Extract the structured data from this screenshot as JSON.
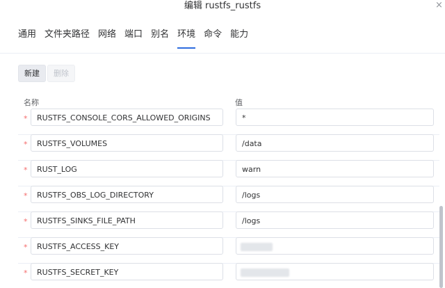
{
  "dialog": {
    "title": "编辑 rustfs_rustfs",
    "close_label": "×"
  },
  "tabs": [
    {
      "label": "通用",
      "active": false
    },
    {
      "label": "文件夹路径",
      "active": false
    },
    {
      "label": "网络",
      "active": false
    },
    {
      "label": "端口",
      "active": false
    },
    {
      "label": "别名",
      "active": false
    },
    {
      "label": "环境",
      "active": true
    },
    {
      "label": "命令",
      "active": false
    },
    {
      "label": "能力",
      "active": false
    }
  ],
  "toolbar": {
    "new_label": "新建",
    "delete_label": "删除"
  },
  "columns": {
    "name": "名称",
    "value": "值"
  },
  "required_marker": "*",
  "rows": [
    {
      "name": "RUSTFS_CONSOLE_CORS_ALLOWED_ORIGINS",
      "value": "*"
    },
    {
      "name": "RUSTFS_VOLUMES",
      "value": "/data"
    },
    {
      "name": "RUST_LOG",
      "value": "warn"
    },
    {
      "name": "RUSTFS_OBS_LOG_DIRECTORY",
      "value": "/logs"
    },
    {
      "name": "RUSTFS_SINKS_FILE_PATH",
      "value": "/logs"
    },
    {
      "name": "RUSTFS_ACCESS_KEY",
      "value": ""
    },
    {
      "name": "RUSTFS_SECRET_KEY",
      "value": ""
    }
  ],
  "colors": {
    "accent": "#2d6cdf",
    "required": "#f56c6c",
    "border": "#dcdfe6"
  }
}
